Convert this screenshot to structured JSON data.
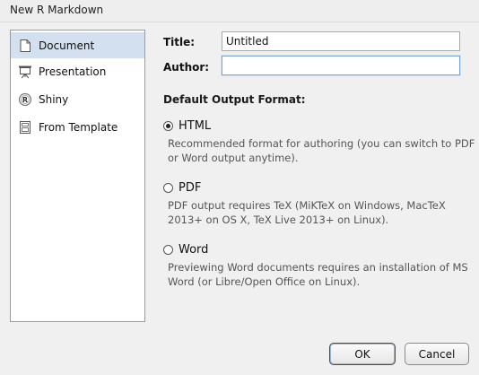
{
  "window": {
    "title": "New R Markdown"
  },
  "sidebar": {
    "items": [
      {
        "label": "Document",
        "icon": "document-icon",
        "selected": true
      },
      {
        "label": "Presentation",
        "icon": "presentation-icon",
        "selected": false
      },
      {
        "label": "Shiny",
        "icon": "shiny-r-icon",
        "selected": false
      },
      {
        "label": "From Template",
        "icon": "template-icon",
        "selected": false
      }
    ]
  },
  "form": {
    "title_label": "Title:",
    "title_value": "Untitled",
    "author_label": "Author:",
    "author_value": ""
  },
  "output": {
    "heading": "Default Output Format:",
    "options": [
      {
        "label": "HTML",
        "checked": true,
        "description": [
          "Recommended format for authoring (you can switch to PDF",
          "or Word output anytime)."
        ]
      },
      {
        "label": "PDF",
        "checked": false,
        "description": [
          "PDF output requires TeX (MiKTeX on Windows, MacTeX",
          "2013+ on OS X, TeX Live 2013+ on Linux)."
        ]
      },
      {
        "label": "Word",
        "checked": false,
        "description": [
          "Previewing Word documents requires an installation of MS",
          "Word (or Libre/Open Office on Linux)."
        ]
      }
    ]
  },
  "buttons": {
    "ok": "OK",
    "cancel": "Cancel"
  },
  "colors": {
    "selected_bg": "#d3e0ef",
    "focus_border": "#7aa7d6"
  }
}
